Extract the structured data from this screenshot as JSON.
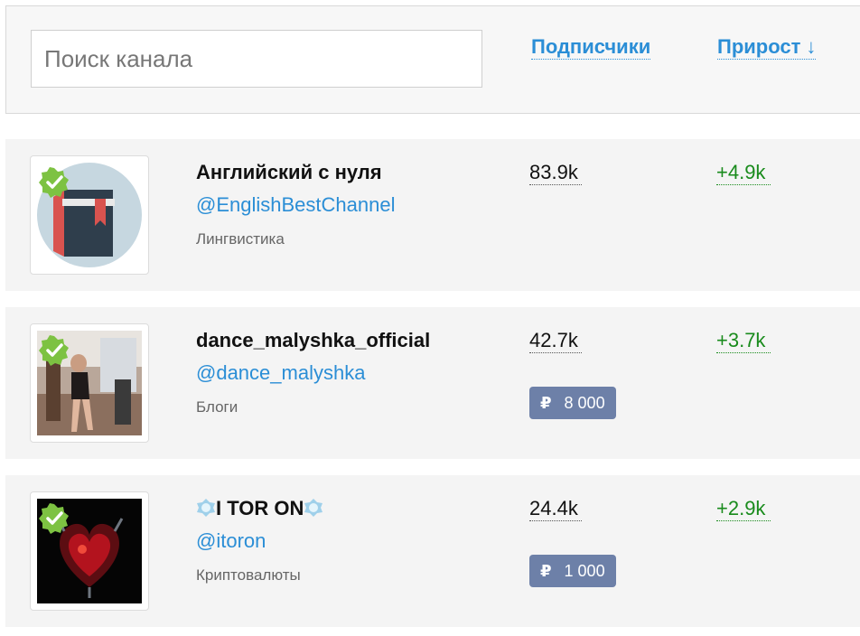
{
  "search": {
    "placeholder": "Поиск канала"
  },
  "columns": {
    "subscribers_label": "Подписчики",
    "growth_label": "Прирост",
    "sort_arrow": "↓"
  },
  "channels": [
    {
      "title": "Английский с нуля",
      "handle": "@EnglishBestChannel",
      "category": "Лингвистика",
      "subscribers": "83.9k",
      "growth": "+4.9k",
      "verified": true,
      "avatar_icon": "book-icon"
    },
    {
      "title": "dance_malyshka_official",
      "handle": "@dance_malyshka",
      "category": "Блоги",
      "subscribers": "42.7k",
      "growth": "+3.7k",
      "price_currency": "₽",
      "price": "8 000",
      "verified": true,
      "avatar_icon": "photo-avatar"
    },
    {
      "title": "I TOR ON",
      "handle": "@itoron",
      "category": "Криптовалюты",
      "subscribers": "24.4k",
      "growth": "+2.9k",
      "price_currency": "₽",
      "price": "1 000",
      "verified": true,
      "avatar_icon": "heart-art-avatar"
    }
  ],
  "colors": {
    "link": "#2b8ed6",
    "growth": "#198b1c",
    "verified": "#7dc242",
    "price_badge": "#6d80a8"
  }
}
